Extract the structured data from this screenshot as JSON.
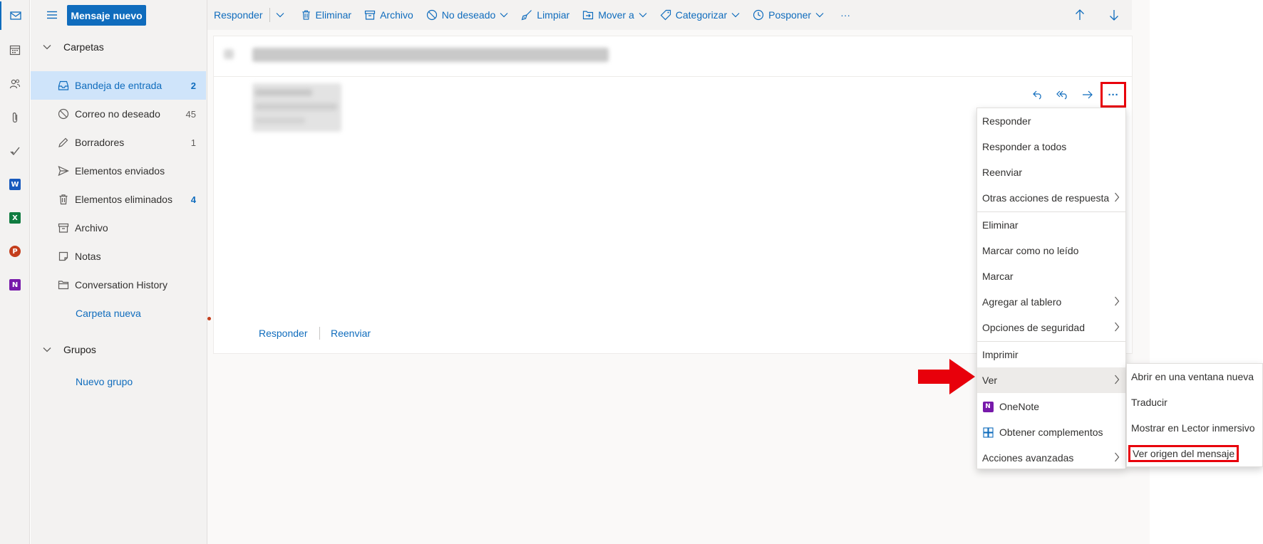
{
  "colors": {
    "accent": "#0f6cbd",
    "highlight": "#e8000b",
    "selected": "#cfe4fa"
  },
  "rail": {
    "icons": [
      "mail-icon",
      "calendar-icon",
      "people-icon",
      "attachment-icon",
      "todo-icon",
      "word-icon",
      "excel-icon",
      "powerpoint-icon",
      "onenote-icon"
    ]
  },
  "folder_pane": {
    "new_mail": "Mensaje nuevo",
    "folders_header": "Carpetas",
    "folders": [
      {
        "label": "Bandeja de entrada",
        "count": "2",
        "icon": "inbox-icon"
      },
      {
        "label": "Correo no deseado",
        "count": "45",
        "icon": "junk-icon"
      },
      {
        "label": "Borradores",
        "count": "1",
        "icon": "pencil-icon"
      },
      {
        "label": "Elementos enviados",
        "count": "",
        "icon": "send-icon"
      },
      {
        "label": "Elementos eliminados",
        "count": "4",
        "icon": "trash-icon"
      },
      {
        "label": "Archivo",
        "count": "",
        "icon": "archive-icon"
      },
      {
        "label": "Notas",
        "count": "",
        "icon": "note-icon"
      },
      {
        "label": "Conversation History",
        "count": "",
        "icon": "folder-icon"
      }
    ],
    "new_folder": "Carpeta nueva",
    "groups_header": "Grupos",
    "new_group": "Nuevo grupo"
  },
  "toolbar": {
    "reply": "Responder",
    "delete": "Eliminar",
    "archive": "Archivo",
    "junk": "No deseado",
    "sweep": "Limpiar",
    "move": "Mover a",
    "categorize": "Categorizar",
    "snooze": "Posponer",
    "more": "···"
  },
  "reading": {
    "reply_link": "Responder",
    "forward_link": "Reenviar",
    "more_label": "···"
  },
  "menu": {
    "items": [
      "Responder",
      "Responder a todos",
      "Reenviar",
      "Otras acciones de respuesta",
      "Eliminar",
      "Marcar como no leído",
      "Marcar",
      "Agregar al tablero",
      "Opciones de seguridad",
      "Imprimir",
      "Ver",
      "OneNote",
      "Obtener complementos",
      "Acciones avanzadas"
    ]
  },
  "submenu": {
    "items": [
      "Abrir en una ventana nueva",
      "Traducir",
      "Mostrar en Lector inmersivo",
      "Ver origen del mensaje"
    ]
  }
}
